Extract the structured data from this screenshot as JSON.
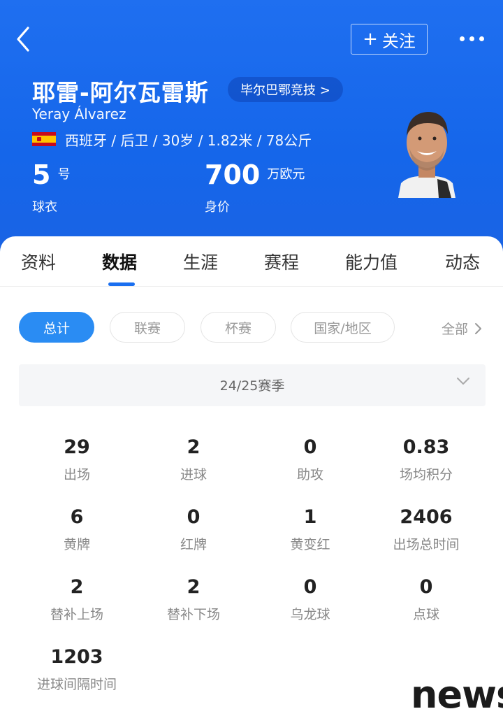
{
  "header": {
    "follow_label": "关注",
    "player_name": "耶雷-阿尔瓦雷斯",
    "club": "毕尔巴鄂竞技 >",
    "player_name_en": "Yeray Álvarez",
    "info": "西班牙 / 后卫 / 30岁 / 1.82米 / 78公斤",
    "shirt_number": "5",
    "shirt_unit": "号",
    "shirt_label": "球衣",
    "market_value": "700",
    "value_unit": "万欧元",
    "value_label": "身价"
  },
  "tabs": [
    "资料",
    "数据",
    "生涯",
    "赛程",
    "能力值",
    "动态"
  ],
  "active_tab": "数据",
  "filters": [
    "总计",
    "联赛",
    "杯赛",
    "国家/地区"
  ],
  "active_filter": "总计",
  "all_link": "全部",
  "season": "24/25赛季",
  "stats": [
    {
      "value": "29",
      "label": "出场"
    },
    {
      "value": "2",
      "label": "进球"
    },
    {
      "value": "0",
      "label": "助攻"
    },
    {
      "value": "0.83",
      "label": "场均积分"
    },
    {
      "value": "6",
      "label": "黄牌"
    },
    {
      "value": "0",
      "label": "红牌"
    },
    {
      "value": "1",
      "label": "黄变红"
    },
    {
      "value": "2406",
      "label": "出场总时间"
    },
    {
      "value": "2",
      "label": "替补上场"
    },
    {
      "value": "2",
      "label": "替补下场"
    },
    {
      "value": "0",
      "label": "乌龙球"
    },
    {
      "value": "0",
      "label": "点球"
    },
    {
      "value": "1203",
      "label": "进球间隔时间"
    }
  ],
  "watermark": "news",
  "colors": {
    "header_blue": "#1566ea",
    "accent": "#2a8cf3"
  }
}
